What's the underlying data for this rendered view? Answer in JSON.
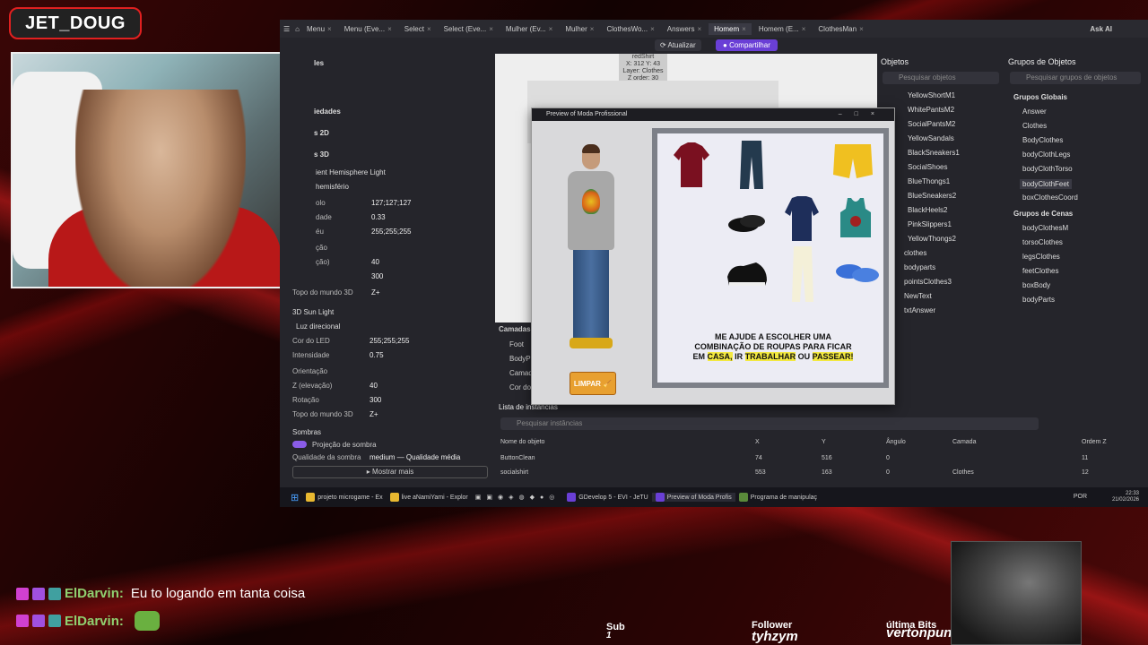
{
  "stream": {
    "brand": "JET_DOUG",
    "chat": [
      {
        "user": "ElDarvin:",
        "message": "Eu to logando em tanta coisa"
      },
      {
        "user": "ElDarvin:",
        "message": ""
      }
    ],
    "sub_label": "Sub",
    "sub_value": "1",
    "follower_label": "Follower",
    "follower_value": "tyhzym",
    "bits_label": "última Bits",
    "bits_value": "vertonpunk - 10"
  },
  "tabs": [
    {
      "label": "Menu"
    },
    {
      "label": "Menu (Eve..."
    },
    {
      "label": "Select"
    },
    {
      "label": "Select (Eve..."
    },
    {
      "label": "Mulher (Ev..."
    },
    {
      "label": "Mulher"
    },
    {
      "label": "ClothesWo..."
    },
    {
      "label": "Answers"
    },
    {
      "label": "Homem"
    },
    {
      "label": "Homem (E..."
    },
    {
      "label": "ClothesMan"
    }
  ],
  "user_label": "Ask AI",
  "toolbar": {
    "update_label": "Atualizar",
    "share_label": "Compartilhar"
  },
  "properties": {
    "header_items": [
      "les",
      "iedades",
      "s 2D",
      "s 3D"
    ],
    "ambient": {
      "title": "ient Hemisphere Light",
      "hemisfério": "hemisfério",
      "rows": [
        {
          "label": "olo",
          "value": "127;127;127"
        },
        {
          "label": "dade",
          "value": "0.33"
        },
        {
          "label": "éu",
          "value": "255;255;255"
        },
        {
          "label": "ção",
          "value": ""
        },
        {
          "label": "ção)",
          "value": "40"
        },
        {
          "label": "",
          "value": "300"
        },
        {
          "label": "Topo do mundo 3D",
          "value": "Z+"
        }
      ]
    },
    "sun": {
      "title": "3D Sun Light",
      "type": "Luz direcional",
      "rows": [
        {
          "label": "Cor do LED",
          "value": "255;255;255"
        },
        {
          "label": "Intensidade",
          "value": "0.75"
        },
        {
          "label": "Orientação",
          "value": ""
        },
        {
          "label": "Z (elevação)",
          "value": "40"
        },
        {
          "label": "Rotação",
          "value": "300"
        },
        {
          "label": "Topo do mundo 3D",
          "value": "Z+"
        }
      ]
    },
    "shadows_title": "Sombras",
    "shadow_projection": "Projeção de sombra",
    "shadow_quality_label": "Qualidade da sombra",
    "shadow_quality_value": "medium — Qualidade média",
    "more_label": "Mostrar mais"
  },
  "tooltip": {
    "line1": "redShirt",
    "line2": "X: 312  Y: 43",
    "line3": "Layer: Clothes",
    "line4": "Z order: 30"
  },
  "objects": {
    "title": "Objetos",
    "search_placeholder": "Pesquisar objetos",
    "items": [
      "YellowShortM1",
      "WhitePantsM2",
      "SocialPantsM2",
      "YellowSandals",
      "BlackSneakers1",
      "SocialShoes",
      "BlueThongs1",
      "BlueSneakers2",
      "BlackHeels2",
      "PinkSlippers1",
      "YellowThongs2",
      "clothes",
      "bodyparts",
      "pointsClothes3",
      "NewText",
      "txtAnswer"
    ]
  },
  "groups": {
    "title": "Grupos de Objetos",
    "search_placeholder": "Pesquisar grupos de objetos",
    "global_title": "Grupos Globais",
    "global_items": [
      "Answer",
      "Clothes",
      "BodyClothes",
      "bodyClothLegs",
      "bodyClothTorso",
      "bodyClothFeet",
      "boxClothesCoord"
    ],
    "scene_title": "Grupos de Cenas",
    "scene_items": [
      "bodyClothesM",
      "torsoClothes",
      "legsClothes",
      "feetClothes",
      "boxBody",
      "bodyParts"
    ]
  },
  "layers": {
    "title": "Camadas",
    "items": [
      "Foot",
      "BodyPa",
      "Camada",
      "Cor do"
    ]
  },
  "instances": {
    "title": "Lista de instâncias",
    "search_placeholder": "Pesquisar instâncias",
    "columns": [
      "Nome do objeto",
      "X",
      "Y",
      "Ângulo",
      "Camada",
      "Ordem Z"
    ],
    "rows": [
      [
        "ButtonClean",
        "74",
        "516",
        "0",
        "",
        "11"
      ],
      [
        "socialshirt",
        "553",
        "163",
        "0",
        "Clothes",
        "12"
      ]
    ]
  },
  "preview": {
    "title": "Preview of Moda Profissional",
    "button": "LIMPAR",
    "prompt_line1": "ME AJUDE A ESCOLHER UMA",
    "prompt_line2": "COMBINAÇÃO DE ROUPAS PARA FICAR",
    "prompt_em": "EM",
    "prompt_casa": "CASA,",
    "prompt_ir": "IR",
    "prompt_trabalhar": "TRABALHAR",
    "prompt_ou": "OU",
    "prompt_passear": "PASSEAR!"
  },
  "taskbar": {
    "items": [
      "projeto microgame - Ex",
      "live aNamiYami - Explor",
      "GDevelop 5 - EVI - JeTU",
      "Preview of Moda Profis",
      "Programa de manipulaç"
    ],
    "lang": "POR",
    "time": "22:33",
    "date": "21/02/2026"
  },
  "colors": {
    "accent": "#6a3fd6",
    "stream_red": "#e02020",
    "highlight": "#f2e840"
  }
}
